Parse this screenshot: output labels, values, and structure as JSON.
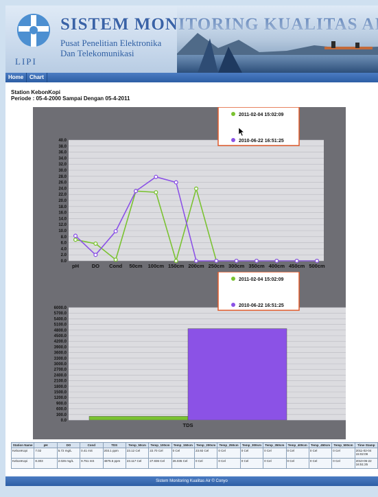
{
  "header": {
    "title": "SISTEM MONITORING KUALITAS AIR",
    "subtitle_line1": "Pusat Penelitian Elektronika",
    "subtitle_line2": "Dan Telekomunikasi",
    "logo_text": "LIPI"
  },
  "nav": {
    "items": [
      {
        "label": "Home"
      },
      {
        "label": "Chart"
      }
    ]
  },
  "info": {
    "station": "Station KebonKopi",
    "period": "Periode : 05-4-2000 Sampai Dengan 05-4-2011"
  },
  "colors": {
    "series1": "#7ac231",
    "series2": "#8b52e6",
    "plot_bg": "#dcdce0",
    "panel_bg": "#6e6e74",
    "legend_border": "#e05a2a"
  },
  "chart_data": [
    {
      "type": "line",
      "categories": [
        "pH",
        "DO",
        "Cond",
        "50cm",
        "100cm",
        "150cm",
        "200cm",
        "250cm",
        "300cm",
        "350cm",
        "400cm",
        "450cm",
        "500cm"
      ],
      "ylim": [
        0,
        40
      ],
      "y_ticks": [
        "0.0",
        "2.0",
        "4.0",
        "6.0",
        "8.0",
        "10.0",
        "12.0",
        "14.0",
        "16.0",
        "18.0",
        "20.0",
        "22.0",
        "24.0",
        "26.0",
        "28.0",
        "30.0",
        "32.0",
        "34.0",
        "36.0",
        "38.0",
        "40.0"
      ],
      "grid": true,
      "legend_position": "top-right",
      "series": [
        {
          "name": "2011-02-04 15:02:09",
          "values": [
            7.0,
            5.7,
            0.4,
            23.1,
            22.7,
            0,
            23.9,
            0,
            0,
            0,
            0,
            0,
            0
          ]
        },
        {
          "name": "2010-06-22 16:51:25",
          "values": [
            8.3,
            2.0,
            9.8,
            23.1,
            27.8,
            26.0,
            0,
            0,
            0,
            0,
            0,
            0,
            0
          ]
        }
      ]
    },
    {
      "type": "bar",
      "categories": [
        "TDS"
      ],
      "ylim": [
        0,
        6000
      ],
      "y_ticks": [
        "0.0",
        "300.0",
        "600.0",
        "900.0",
        "1200.0",
        "1500.0",
        "1800.0",
        "2100.0",
        "2400.0",
        "2700.0",
        "3000.0",
        "3300.0",
        "3600.0",
        "3900.0",
        "4200.0",
        "4500.0",
        "4800.0",
        "5100.0",
        "5400.0",
        "5700.0",
        "6000.0"
      ],
      "grid": true,
      "legend_position": "top-right",
      "series": [
        {
          "name": "2011-02-04 15:02:09",
          "values": [
            203.1
          ]
        },
        {
          "name": "2010-06-22 16:51:25",
          "values": [
            4875.5
          ]
        }
      ]
    }
  ],
  "table": {
    "headers": [
      "Station Name",
      "pH",
      "DO",
      "Cond",
      "TDS",
      "Temp_50cm",
      "Temp_100cm",
      "Temp_150cm",
      "Temp_200cm",
      "Temp_250cm",
      "Temp_300cm",
      "Temp_350cm",
      "Temp_400cm",
      "Temp_450cm",
      "Temp_500cm",
      "Time Stamp"
    ],
    "rows": [
      [
        "KebonKopi",
        "7.02",
        "5.72 mg/L",
        "0.41 mS",
        "203.1 ppm",
        "23.12 Cel",
        "22.70 Cel",
        "0 Cel",
        "23.92 Cel",
        "0 Cel",
        "0 Cel",
        "0 Cel",
        "0 Cel",
        "0 Cel",
        "0 Cel",
        "2011-02-04 15:02:09"
      ],
      [
        "KebonKopi",
        "8.303",
        "2.026 mg/L",
        "9.751 mS",
        "4875.5 ppm",
        "23.117 Cel",
        "27.836 Cel",
        "26.035 Cel",
        "0 Cel",
        "0 Cel",
        "0 Cel",
        "0 Cel",
        "0 Cel",
        "0 Cel",
        "0 Cel",
        "2010-06-22 16:51:25"
      ]
    ]
  },
  "footer": {
    "text": "Sistem Monitoring Kualitas Air © Conyo"
  }
}
